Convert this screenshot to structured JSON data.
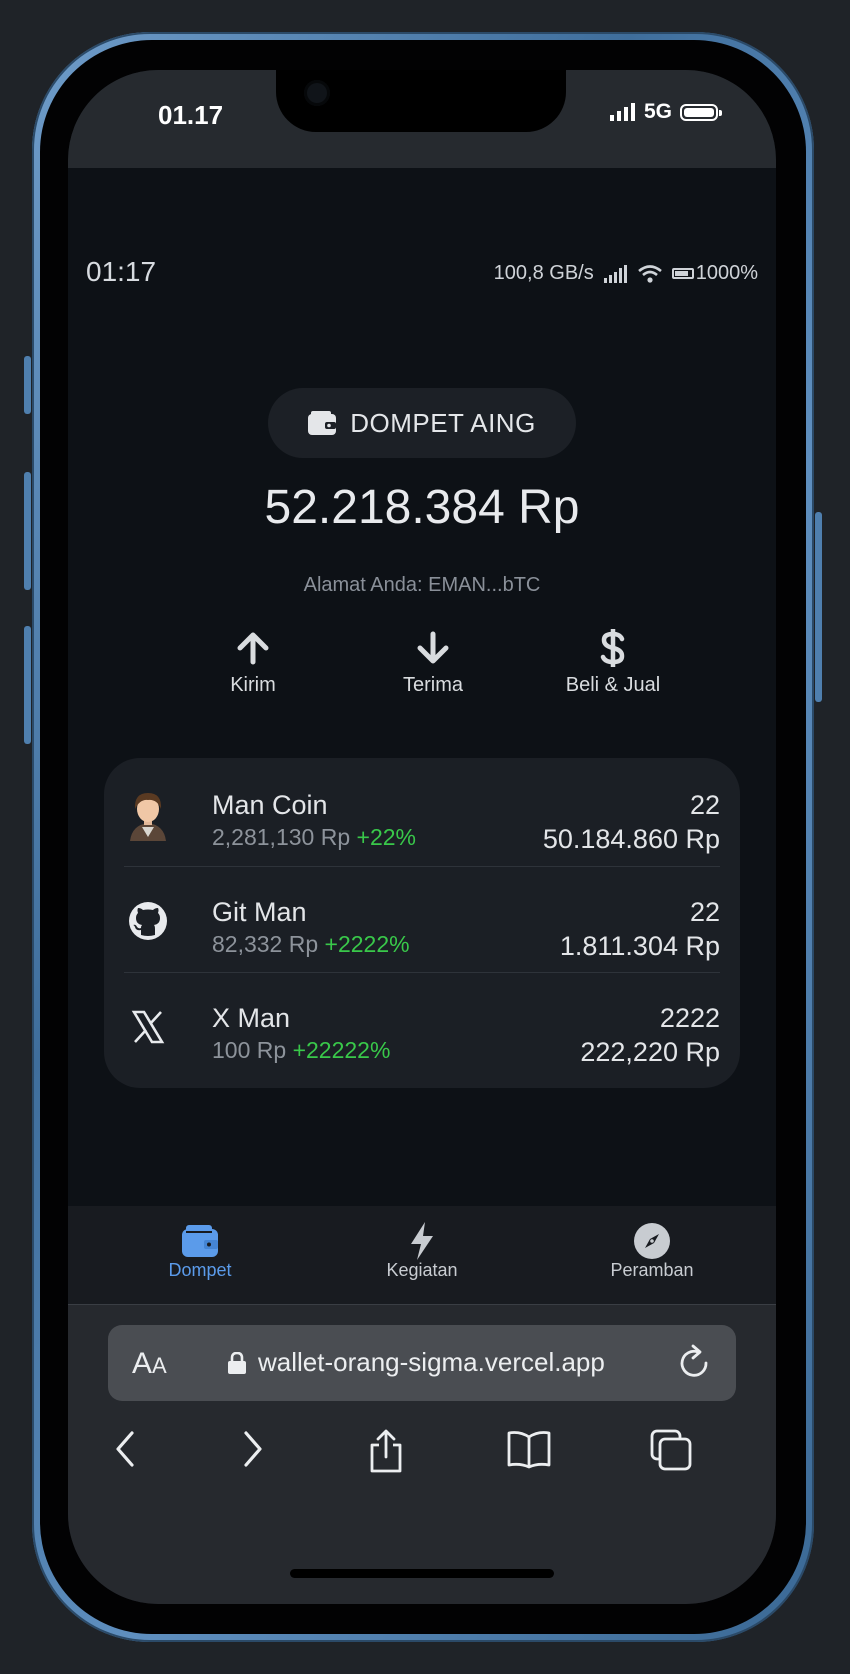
{
  "device_status": {
    "time": "01.17",
    "network": "5G"
  },
  "app_status": {
    "time": "01:17",
    "speed": "100,8 GB/s",
    "battery": "1000%"
  },
  "wallet": {
    "name": "DOMPET AING",
    "balance": "52.218.384 Rp",
    "address": "Alamat Anda: EMAN...bTC"
  },
  "actions": [
    {
      "label": "Kirim",
      "icon": "arrow-up-icon"
    },
    {
      "label": "Terima",
      "icon": "arrow-down-icon"
    },
    {
      "label": "Beli & Jual",
      "icon": "dollar-icon"
    }
  ],
  "tokens": [
    {
      "name": "Man Coin",
      "price": "2,281,130 Rp",
      "change": "+22%",
      "amount": "22",
      "value": "50.184.860 Rp",
      "icon": "avatar-icon"
    },
    {
      "name": "Git Man",
      "price": "82,332 Rp",
      "change": "+2222%",
      "amount": "22",
      "value": "1.811.304 Rp",
      "icon": "github-icon"
    },
    {
      "name": "X Man",
      "price": "100 Rp",
      "change": "+22222%",
      "amount": "2222",
      "value": "222,220 Rp",
      "icon": "x-logo-icon"
    }
  ],
  "nav": [
    {
      "label": "Dompet",
      "icon": "wallet-icon",
      "active": true
    },
    {
      "label": "Kegiatan",
      "icon": "bolt-icon",
      "active": false
    },
    {
      "label": "Peramban",
      "icon": "compass-icon",
      "active": false
    }
  ],
  "browser": {
    "aa": "A",
    "aa_small": "A",
    "url": "wallet-orang-sigma.vercel.app"
  },
  "colors": {
    "accent": "#5b9bea",
    "positive": "#39c84a",
    "background": "#0d1116"
  }
}
